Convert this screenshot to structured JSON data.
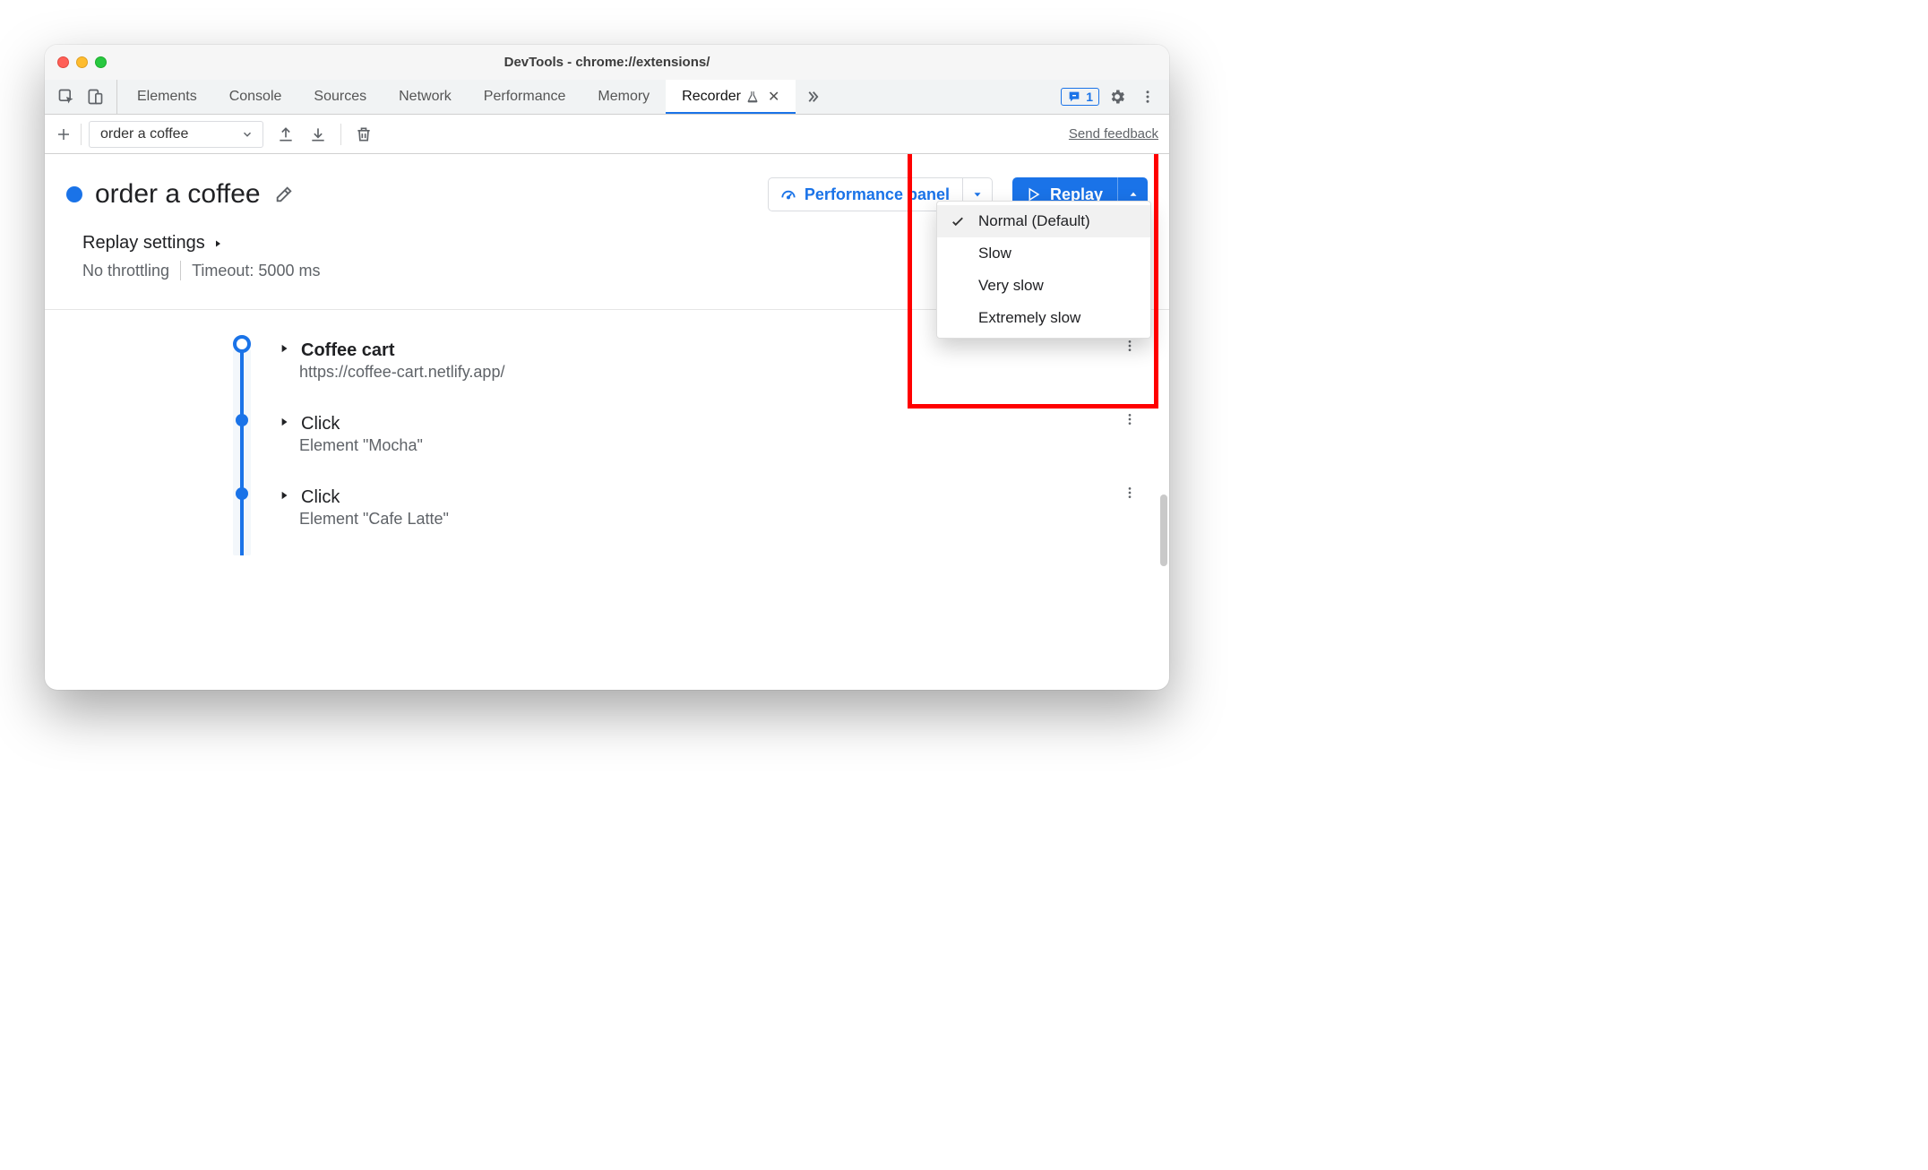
{
  "window": {
    "title": "DevTools - chrome://extensions/"
  },
  "tabs": {
    "items": [
      "Elements",
      "Console",
      "Sources",
      "Network",
      "Performance",
      "Memory",
      "Recorder"
    ],
    "activeIndex": 6
  },
  "feedbackBadgeCount": "1",
  "recorderToolbar": {
    "selectedFlow": "order a coffee",
    "sendFeedback": "Send feedback"
  },
  "recording": {
    "title": "order a coffee",
    "performancePanel": "Performance panel",
    "replayLabel": "Replay"
  },
  "replaySettings": {
    "heading": "Replay settings",
    "throttling": "No throttling",
    "timeout": "Timeout: 5000 ms"
  },
  "steps": [
    {
      "title": "Coffee cart",
      "subtitle": "https://coffee-cart.netlify.app/",
      "big": true
    },
    {
      "title": "Click",
      "subtitle": "Element \"Mocha\"",
      "big": false
    },
    {
      "title": "Click",
      "subtitle": "Element \"Cafe Latte\"",
      "big": false
    }
  ],
  "speedMenu": {
    "options": [
      "Normal (Default)",
      "Slow",
      "Very slow",
      "Extremely slow"
    ],
    "selectedIndex": 0
  }
}
